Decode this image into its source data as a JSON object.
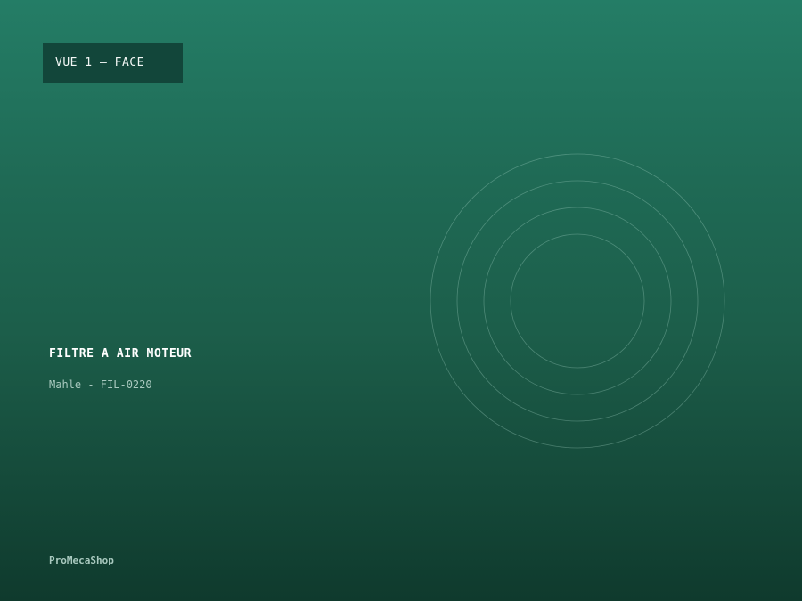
{
  "view": {
    "label": "VUE 1 — FACE"
  },
  "product": {
    "name": "FILTRE A AIR MOTEUR",
    "subtitle": "Mahle - FIL-0220"
  },
  "brand": {
    "name": "ProMecaShop"
  },
  "colors": {
    "gradient_top": "#247d66",
    "gradient_bottom": "#0f3a2d",
    "label_bg": "#12463a",
    "muted_text": "#a9c9bf"
  },
  "icons": {
    "illustration": "concentric-circles-filter-icon"
  }
}
